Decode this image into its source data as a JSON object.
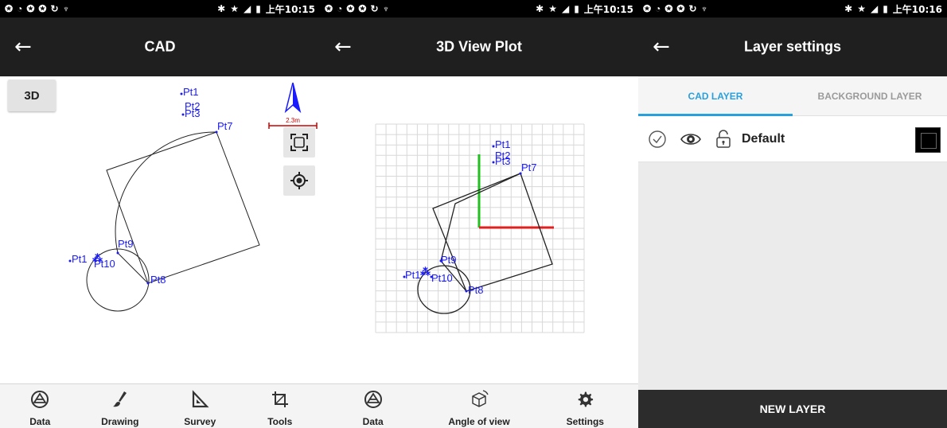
{
  "status_bars": [
    {
      "time": "上午10:15"
    },
    {
      "time": "上午10:15"
    },
    {
      "time": "上午10:16"
    }
  ],
  "cad": {
    "title": "CAD",
    "back_icon": "arrow-left-icon",
    "btn_3d": "3D",
    "scale_label": "2.3m",
    "points": [
      "Pt1",
      "Pt2",
      "Pt3",
      "Pt7",
      "Pt9",
      "Pt10",
      "Pt8",
      "Pt1"
    ],
    "nav": [
      {
        "label": "Data",
        "icon": "data-icon"
      },
      {
        "label": "Drawing",
        "icon": "brush-icon"
      },
      {
        "label": "Survey",
        "icon": "set-square-icon"
      },
      {
        "label": "Tools",
        "icon": "crop-tools-icon"
      }
    ]
  },
  "view3d": {
    "title": "3D View Plot",
    "back_icon": "arrow-left-icon",
    "points": [
      "Pt1",
      "Pt2",
      "Pt3",
      "Pt7",
      "Pt9",
      "Pt10",
      "Pt8",
      "Pt1"
    ],
    "nav": [
      {
        "label": "Data",
        "icon": "data-icon"
      },
      {
        "label": "Angle of view",
        "icon": "cube-rotate-icon"
      },
      {
        "label": "Settings",
        "icon": "gear-icon"
      }
    ]
  },
  "layers": {
    "title": "Layer settings",
    "back_icon": "arrow-left-icon",
    "tabs": [
      {
        "label": "CAD LAYER",
        "active": true
      },
      {
        "label": "BACKGROUND LAYER",
        "active": false
      }
    ],
    "rows": [
      {
        "name": "Default",
        "color": "#000000"
      }
    ],
    "new_button": "NEW LAYER"
  },
  "colors": {
    "point_blue": "#1a1aff",
    "tab_accent": "#29a0dc",
    "axis_red": "#e02020",
    "axis_green": "#20c020"
  }
}
